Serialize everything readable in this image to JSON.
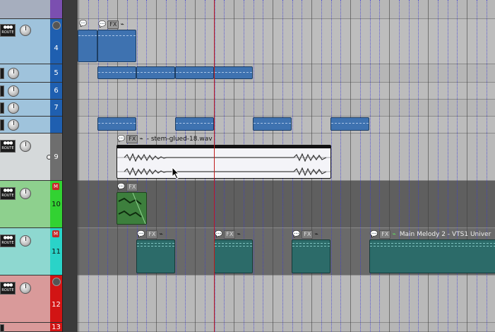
{
  "tracks": [
    {
      "number": "4",
      "color": "#1f5fb0",
      "panel_color": "#9fc3dc",
      "route_label": "ROUTE",
      "mute": ""
    },
    {
      "number": "5",
      "color": "#1f5fb0",
      "panel_color": "#9fc3dc"
    },
    {
      "number": "6",
      "color": "#1f5fb0",
      "panel_color": "#9fc3dc"
    },
    {
      "number": "7",
      "color": "#1f5fb0",
      "panel_color": "#9fc3dc"
    },
    {
      "number": "",
      "color": "#1f5fb0",
      "panel_color": "#9fc3dc"
    },
    {
      "number": "9",
      "color": "#6e6e6e",
      "panel_color": "#d5d9da",
      "route_label": "ROUTE"
    },
    {
      "number": "10",
      "color": "#32d232",
      "panel_color": "#8ed08e",
      "route_label": "ROUTE",
      "mute": "M"
    },
    {
      "number": "11",
      "color": "#2ad3c8",
      "panel_color": "#8ed8d0",
      "route_label": "ROUTE",
      "mute": "M"
    },
    {
      "number": "12",
      "color": "#d21414",
      "panel_color": "#d99a9a",
      "route_label": "ROUTE"
    },
    {
      "number": "13",
      "color": "#d21414",
      "panel_color": "#d99a9a"
    }
  ],
  "items": {
    "fx_label": "FX",
    "stem_name": "- stem-glued-18.wav",
    "melody_name": "Main Melody 2 - VTS1 Univer"
  },
  "colors": {
    "accent_blue": "#3e72b0",
    "teal_item": "#2c6b69",
    "edit_cursor": "#c01a1a"
  }
}
